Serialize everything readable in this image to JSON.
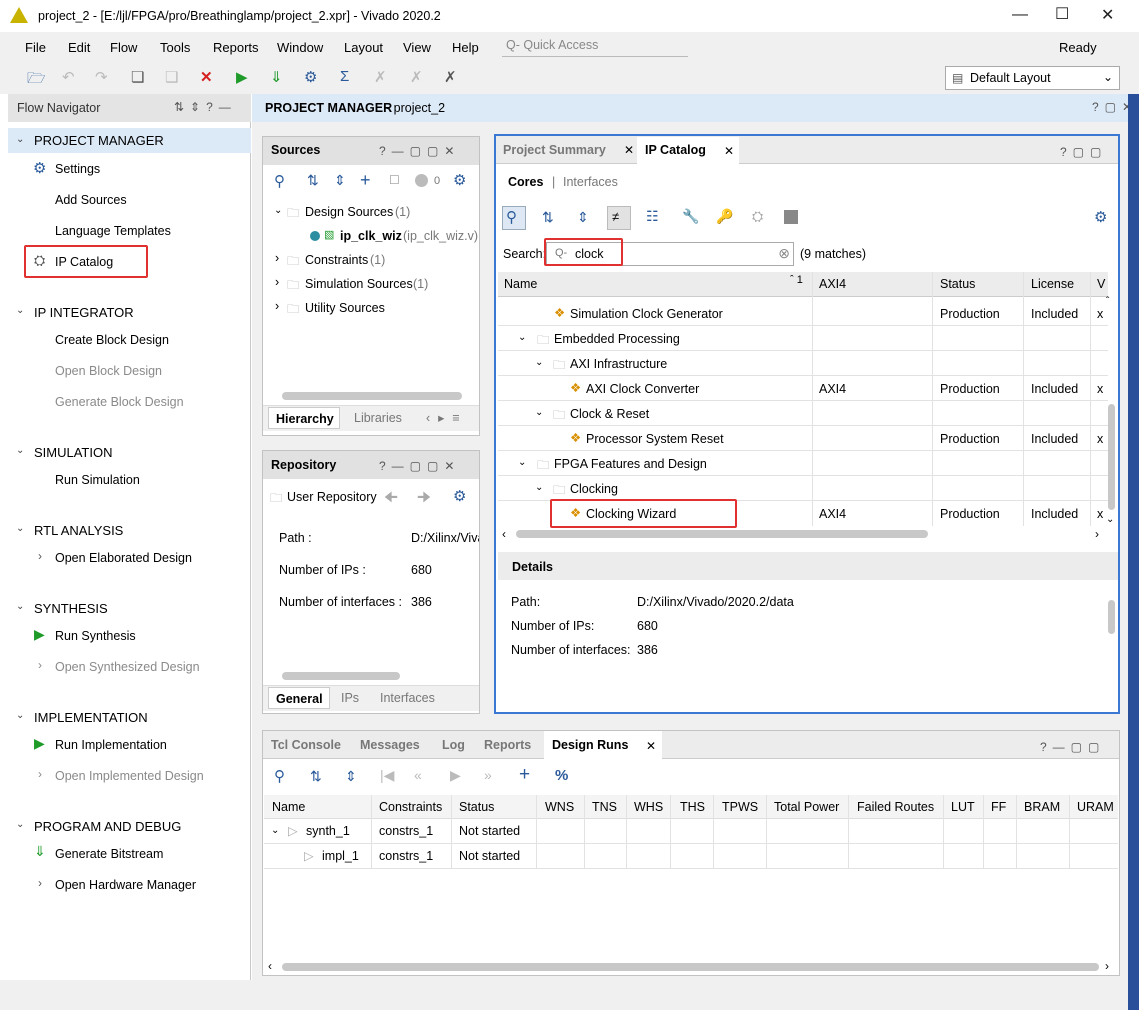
{
  "title": "project_2 - [E:/ljl/FPGA/pro/Breathinglamp/project_2.xpr] - Vivado 2020.2",
  "menus": [
    "File",
    "Edit",
    "Flow",
    "Tools",
    "Reports",
    "Window",
    "Layout",
    "View",
    "Help"
  ],
  "quick_access": "Q- Quick Access",
  "ready": "Ready",
  "layout": "Default Layout",
  "flow_nav": {
    "title": "Flow Navigator",
    "project_manager": "PROJECT MANAGER",
    "settings": "Settings",
    "add_sources": "Add Sources",
    "language_templates": "Language Templates",
    "ip_catalog": "IP Catalog",
    "ip_integrator": "IP INTEGRATOR",
    "create_bd": "Create Block Design",
    "open_bd": "Open Block Design",
    "generate_bd": "Generate Block Design",
    "simulation": "SIMULATION",
    "run_sim": "Run Simulation",
    "rtl": "RTL ANALYSIS",
    "open_elab": "Open Elaborated Design",
    "synthesis": "SYNTHESIS",
    "run_synth": "Run Synthesis",
    "open_synth": "Open Synthesized Design",
    "implementation": "IMPLEMENTATION",
    "run_impl": "Run Implementation",
    "open_impl": "Open Implemented Design",
    "program": "PROGRAM AND DEBUG",
    "gen_bit": "Generate Bitstream",
    "open_hw": "Open Hardware Manager"
  },
  "pm_title": "PROJECT MANAGER",
  "pm_project": " - project_2",
  "sources": {
    "title": "Sources",
    "count": "0",
    "design_sources": "Design Sources",
    "ds_count": "(1)",
    "ip_name": "ip_clk_wiz",
    "ip_file": "(ip_clk_wiz.v)",
    "constraints": "Constraints",
    "c_count": "(1)",
    "sim_sources": "Simulation Sources",
    "s_count": "(1)",
    "utility": "Utility Sources",
    "tab_hier": "Hierarchy",
    "tab_lib": "Libraries"
  },
  "repository": {
    "title": "Repository",
    "user_repo": "User Repository",
    "path_label": "Path :",
    "path_value": "D:/Xilinx/Viva",
    "nips_label": "Number of IPs :",
    "nips": "680",
    "nif_label": "Number of interfaces :",
    "nif": "386",
    "tab_general": "General",
    "tab_ips": "IPs",
    "tab_interfaces": "Interfaces"
  },
  "ipcat": {
    "tab_summary": "Project Summary",
    "tab_catalog": "IP Catalog",
    "cores": "Cores",
    "interfaces": "Interfaces",
    "search_label": "Search:",
    "search_value": "clock",
    "matches": "(9 matches)",
    "cols": [
      "Name",
      "AXI4",
      "Status",
      "License",
      "V"
    ],
    "rows": [
      {
        "name": "Simulation Clock Generator",
        "axi": "",
        "status": "Production",
        "lic": "Included",
        "v": "x"
      },
      {
        "name": "Embedded Processing"
      },
      {
        "name": "AXI Infrastructure"
      },
      {
        "name": "AXI Clock Converter",
        "axi": "AXI4",
        "status": "Production",
        "lic": "Included",
        "v": "x"
      },
      {
        "name": "Clock & Reset"
      },
      {
        "name": "Processor System Reset",
        "axi": "",
        "status": "Production",
        "lic": "Included",
        "v": "x"
      },
      {
        "name": "FPGA Features and Design"
      },
      {
        "name": "Clocking"
      },
      {
        "name": "Clocking Wizard",
        "axi": "AXI4",
        "status": "Production",
        "lic": "Included",
        "v": "x"
      }
    ],
    "details": "Details",
    "d_path_label": "Path:",
    "d_path": "D:/Xilinx/Vivado/2020.2/data",
    "d_nips_label": "Number of IPs:",
    "d_nips": "680",
    "d_nif_label": "Number of interfaces:",
    "d_nif": "386"
  },
  "runs": {
    "tabs": [
      "Tcl Console",
      "Messages",
      "Log",
      "Reports",
      "Design Runs"
    ],
    "cols": [
      "Name",
      "Constraints",
      "Status",
      "WNS",
      "TNS",
      "WHS",
      "THS",
      "TPWS",
      "Total Power",
      "Failed Routes",
      "LUT",
      "FF",
      "BRAM",
      "URAM"
    ],
    "r1_name": "synth_1",
    "r1_con": "constrs_1",
    "r1_status": "Not started",
    "r2_name": "impl_1",
    "r2_con": "constrs_1",
    "r2_status": "Not started"
  }
}
